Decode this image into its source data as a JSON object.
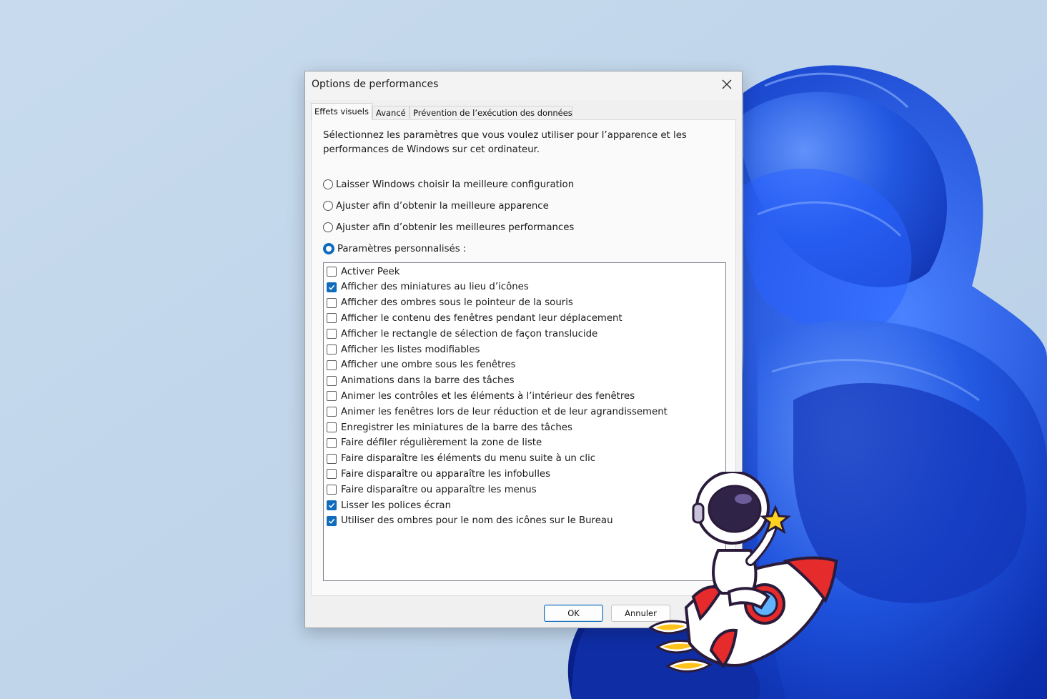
{
  "window": {
    "title": "Options de performances",
    "close_icon": "close-icon"
  },
  "tabs": [
    {
      "label": "Effets visuels",
      "active": true
    },
    {
      "label": "Avancé",
      "active": false
    },
    {
      "label": "Prévention de l’exécution des données",
      "active": false
    }
  ],
  "intro": "Sélectionnez les paramètres que vous voulez utiliser pour l’apparence et les performances de Windows sur cet ordinateur.",
  "radios": [
    {
      "label": "Laisser Windows choisir la meilleure configuration",
      "checked": false
    },
    {
      "label": "Ajuster afin d’obtenir la meilleure apparence",
      "checked": false
    },
    {
      "label": "Ajuster afin d’obtenir les meilleures performances",
      "checked": false
    },
    {
      "label": "Paramètres personnalisés :",
      "checked": true
    }
  ],
  "options": [
    {
      "label": "Activer Peek",
      "checked": false
    },
    {
      "label": "Afficher des miniatures au lieu d’icônes",
      "checked": true
    },
    {
      "label": "Afficher des ombres sous le pointeur de la souris",
      "checked": false
    },
    {
      "label": "Afficher le contenu des fenêtres pendant leur déplacement",
      "checked": false
    },
    {
      "label": "Afficher le rectangle de sélection de façon translucide",
      "checked": false
    },
    {
      "label": "Afficher les listes modifiables",
      "checked": false
    },
    {
      "label": "Afficher une ombre sous les fenêtres",
      "checked": false
    },
    {
      "label": "Animations dans la barre des tâches",
      "checked": false
    },
    {
      "label": "Animer les contrôles et les éléments à l’intérieur des fenêtres",
      "checked": false
    },
    {
      "label": "Animer les fenêtres lors de leur réduction et de leur agrandissement",
      "checked": false
    },
    {
      "label": "Enregistrer les miniatures de la barre des tâches",
      "checked": false
    },
    {
      "label": "Faire défiler régulièrement la zone de liste",
      "checked": false
    },
    {
      "label": "Faire disparaître les éléments du menu suite à un clic",
      "checked": false
    },
    {
      "label": "Faire disparaître ou apparaître les infobulles",
      "checked": false
    },
    {
      "label": "Faire disparaître ou apparaître les menus",
      "checked": false
    },
    {
      "label": "Lisser les polices écran",
      "checked": true
    },
    {
      "label": "Utiliser des ombres pour le nom des icônes sur le Bureau",
      "checked": true
    }
  ],
  "buttons": {
    "ok": "OK",
    "cancel": "Annuler"
  },
  "colors": {
    "accent": "#0f6cbd",
    "desktop_bg": "#c3d6ea",
    "bloom": "#1548d6"
  }
}
